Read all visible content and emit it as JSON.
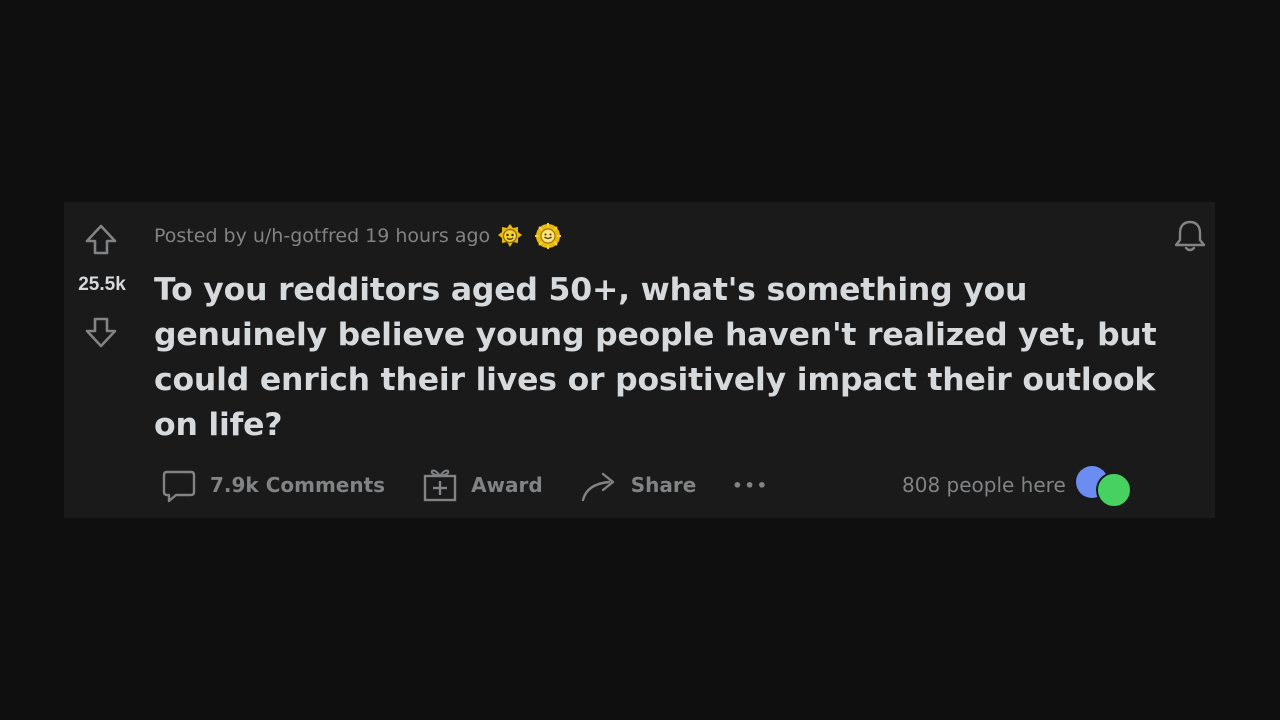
{
  "post": {
    "vote_count": "25.5k",
    "posted_by_prefix": "Posted by",
    "username": "u/h-gotfred",
    "time_ago": "19 hours ago",
    "awards": [
      "gold-award-icon",
      "sun-award-icon"
    ],
    "title": "To you redditors aged 50+, what's something you genuinely believe young people haven't realized yet, but could enrich their lives or positively impact their outlook on life?"
  },
  "actions": {
    "comments_label": "7.9k Comments",
    "award_label": "Award",
    "share_label": "Share",
    "more_label": "•••"
  },
  "presence": {
    "label": "808 people here"
  },
  "colors": {
    "background": "#0f0f10",
    "card": "#1a1a1b",
    "text": "#d7dadc",
    "muted": "#818384",
    "award_gold": "#e8b90c",
    "avatar_blue": "#6b8cf0",
    "avatar_green": "#46d160"
  }
}
